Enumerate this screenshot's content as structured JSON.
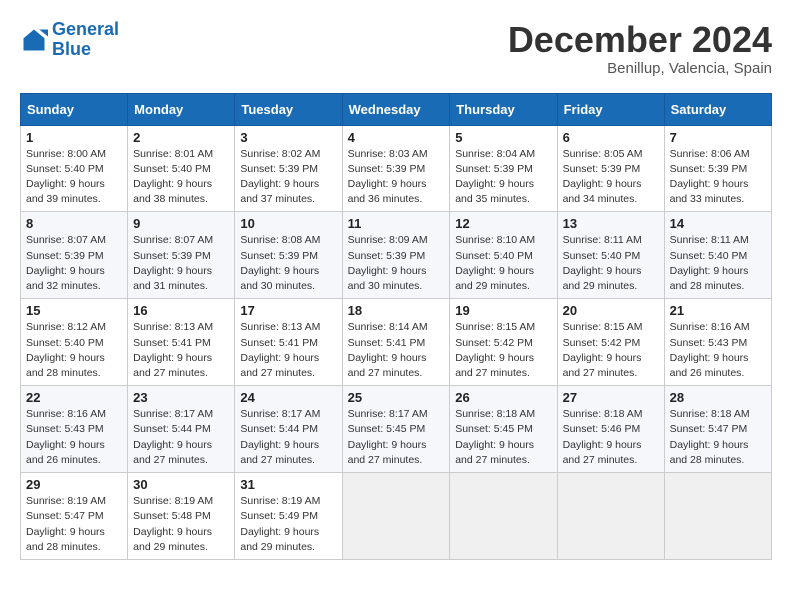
{
  "header": {
    "logo_line1": "General",
    "logo_line2": "Blue",
    "month_title": "December 2024",
    "subtitle": "Benillup, Valencia, Spain"
  },
  "weekdays": [
    "Sunday",
    "Monday",
    "Tuesday",
    "Wednesday",
    "Thursday",
    "Friday",
    "Saturday"
  ],
  "weeks": [
    [
      {
        "day": "1",
        "sunrise": "8:00 AM",
        "sunset": "5:40 PM",
        "daylight": "9 hours and 39 minutes."
      },
      {
        "day": "2",
        "sunrise": "8:01 AM",
        "sunset": "5:40 PM",
        "daylight": "9 hours and 38 minutes."
      },
      {
        "day": "3",
        "sunrise": "8:02 AM",
        "sunset": "5:39 PM",
        "daylight": "9 hours and 37 minutes."
      },
      {
        "day": "4",
        "sunrise": "8:03 AM",
        "sunset": "5:39 PM",
        "daylight": "9 hours and 36 minutes."
      },
      {
        "day": "5",
        "sunrise": "8:04 AM",
        "sunset": "5:39 PM",
        "daylight": "9 hours and 35 minutes."
      },
      {
        "day": "6",
        "sunrise": "8:05 AM",
        "sunset": "5:39 PM",
        "daylight": "9 hours and 34 minutes."
      },
      {
        "day": "7",
        "sunrise": "8:06 AM",
        "sunset": "5:39 PM",
        "daylight": "9 hours and 33 minutes."
      }
    ],
    [
      {
        "day": "8",
        "sunrise": "8:07 AM",
        "sunset": "5:39 PM",
        "daylight": "9 hours and 32 minutes."
      },
      {
        "day": "9",
        "sunrise": "8:07 AM",
        "sunset": "5:39 PM",
        "daylight": "9 hours and 31 minutes."
      },
      {
        "day": "10",
        "sunrise": "8:08 AM",
        "sunset": "5:39 PM",
        "daylight": "9 hours and 30 minutes."
      },
      {
        "day": "11",
        "sunrise": "8:09 AM",
        "sunset": "5:39 PM",
        "daylight": "9 hours and 30 minutes."
      },
      {
        "day": "12",
        "sunrise": "8:10 AM",
        "sunset": "5:40 PM",
        "daylight": "9 hours and 29 minutes."
      },
      {
        "day": "13",
        "sunrise": "8:11 AM",
        "sunset": "5:40 PM",
        "daylight": "9 hours and 29 minutes."
      },
      {
        "day": "14",
        "sunrise": "8:11 AM",
        "sunset": "5:40 PM",
        "daylight": "9 hours and 28 minutes."
      }
    ],
    [
      {
        "day": "15",
        "sunrise": "8:12 AM",
        "sunset": "5:40 PM",
        "daylight": "9 hours and 28 minutes."
      },
      {
        "day": "16",
        "sunrise": "8:13 AM",
        "sunset": "5:41 PM",
        "daylight": "9 hours and 27 minutes."
      },
      {
        "day": "17",
        "sunrise": "8:13 AM",
        "sunset": "5:41 PM",
        "daylight": "9 hours and 27 minutes."
      },
      {
        "day": "18",
        "sunrise": "8:14 AM",
        "sunset": "5:41 PM",
        "daylight": "9 hours and 27 minutes."
      },
      {
        "day": "19",
        "sunrise": "8:15 AM",
        "sunset": "5:42 PM",
        "daylight": "9 hours and 27 minutes."
      },
      {
        "day": "20",
        "sunrise": "8:15 AM",
        "sunset": "5:42 PM",
        "daylight": "9 hours and 27 minutes."
      },
      {
        "day": "21",
        "sunrise": "8:16 AM",
        "sunset": "5:43 PM",
        "daylight": "9 hours and 26 minutes."
      }
    ],
    [
      {
        "day": "22",
        "sunrise": "8:16 AM",
        "sunset": "5:43 PM",
        "daylight": "9 hours and 26 minutes."
      },
      {
        "day": "23",
        "sunrise": "8:17 AM",
        "sunset": "5:44 PM",
        "daylight": "9 hours and 27 minutes."
      },
      {
        "day": "24",
        "sunrise": "8:17 AM",
        "sunset": "5:44 PM",
        "daylight": "9 hours and 27 minutes."
      },
      {
        "day": "25",
        "sunrise": "8:17 AM",
        "sunset": "5:45 PM",
        "daylight": "9 hours and 27 minutes."
      },
      {
        "day": "26",
        "sunrise": "8:18 AM",
        "sunset": "5:45 PM",
        "daylight": "9 hours and 27 minutes."
      },
      {
        "day": "27",
        "sunrise": "8:18 AM",
        "sunset": "5:46 PM",
        "daylight": "9 hours and 27 minutes."
      },
      {
        "day": "28",
        "sunrise": "8:18 AM",
        "sunset": "5:47 PM",
        "daylight": "9 hours and 28 minutes."
      }
    ],
    [
      {
        "day": "29",
        "sunrise": "8:19 AM",
        "sunset": "5:47 PM",
        "daylight": "9 hours and 28 minutes."
      },
      {
        "day": "30",
        "sunrise": "8:19 AM",
        "sunset": "5:48 PM",
        "daylight": "9 hours and 29 minutes."
      },
      {
        "day": "31",
        "sunrise": "8:19 AM",
        "sunset": "5:49 PM",
        "daylight": "9 hours and 29 minutes."
      },
      null,
      null,
      null,
      null
    ]
  ]
}
